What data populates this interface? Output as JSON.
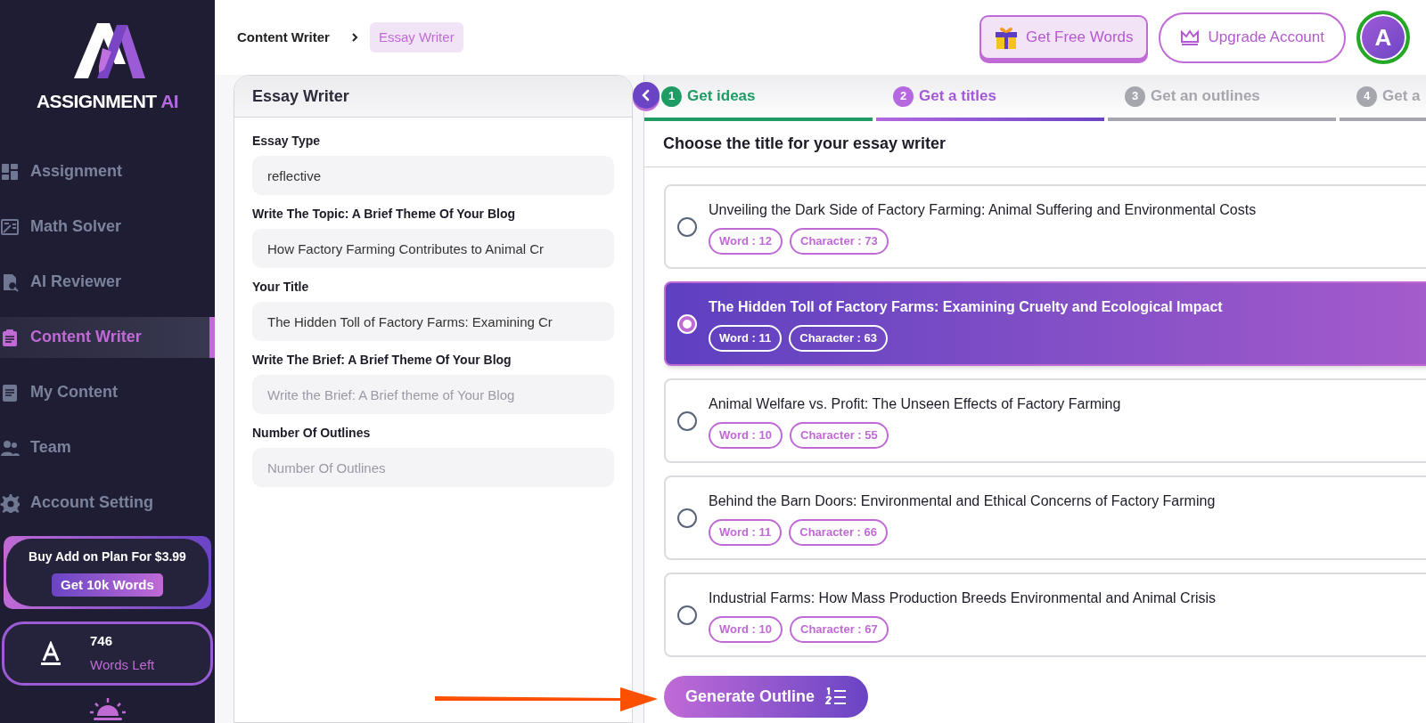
{
  "sidebar": {
    "logo_text": "ASSIGNMENT",
    "logo_accent": "AI",
    "items": [
      {
        "label": "Assignment",
        "kind": "grid",
        "selected": false
      },
      {
        "label": "Math Solver",
        "kind": "math",
        "selected": false
      },
      {
        "label": "AI Reviewer",
        "kind": "review",
        "selected": false
      },
      {
        "label": "Content Writer",
        "kind": "clipboard",
        "selected": true
      },
      {
        "label": "My Content",
        "kind": "doc",
        "selected": false
      },
      {
        "label": "Team",
        "kind": "team",
        "selected": false
      },
      {
        "label": "Account Setting",
        "kind": "gear",
        "selected": false
      }
    ],
    "promo": {
      "text": "Buy Add on Plan For $3.99",
      "button": "Get 10k Words"
    },
    "words": {
      "count": "746",
      "label": "Words Left"
    }
  },
  "breadcrumb": [
    {
      "label": "Content Writer",
      "selected": false
    },
    {
      "label": "Essay Writer",
      "selected": true
    }
  ],
  "header_buttons": {
    "free_words": "Get Free Words",
    "upgrade": "Upgrade Account",
    "avatar": "A"
  },
  "form": {
    "title": "Essay Writer",
    "fields": [
      {
        "label": "Essay Type",
        "value": "reflective"
      },
      {
        "label": "Write The Topic: A Brief Theme Of Your Blog",
        "value": "How Factory Farming Contributes to Animal Cr"
      },
      {
        "label": "Your Title",
        "value": "The Hidden Toll of Factory Farms: Examining Cr"
      },
      {
        "label": "Write The Brief: A Brief Theme Of Your Blog",
        "placeholder": "Write the Brief: A Brief theme of Your Blog"
      },
      {
        "label": "Number Of Outlines",
        "placeholder": "Number Of Outlines"
      }
    ]
  },
  "steps": [
    {
      "number": "1",
      "label": "Get ideas",
      "kind": "done"
    },
    {
      "number": "2",
      "label": "Get a titles",
      "kind": "current"
    },
    {
      "number": "3",
      "label": "Get an outlines",
      "kind": "todo"
    },
    {
      "number": "4",
      "label": "Get a",
      "kind": "todo"
    }
  ],
  "titles_heading": "Choose the title for your essay writer",
  "titles": [
    {
      "title": "Unveiling the Dark Side of Factory Farming: Animal Suffering and Environmental Costs",
      "words": "Word : 12",
      "characters": "Character : 73",
      "selected": false
    },
    {
      "title": "The Hidden Toll of Factory Farms: Examining Cruelty and Ecological Impact",
      "words": "Word : 11",
      "characters": "Character : 63",
      "selected": true
    },
    {
      "title": "Animal Welfare vs. Profit: The Unseen Effects of Factory Farming",
      "words": "Word : 10",
      "characters": "Character : 55",
      "selected": false
    },
    {
      "title": "Behind the Barn Doors: Environmental and Ethical Concerns of Factory Farming",
      "words": "Word : 11",
      "characters": "Character : 66",
      "selected": false
    },
    {
      "title": "Industrial Farms: How Mass Production Breeds Environmental and Animal Crisis",
      "words": "Word : 10",
      "characters": "Character : 67",
      "selected": false
    }
  ],
  "generate_button": "Generate Outline"
}
